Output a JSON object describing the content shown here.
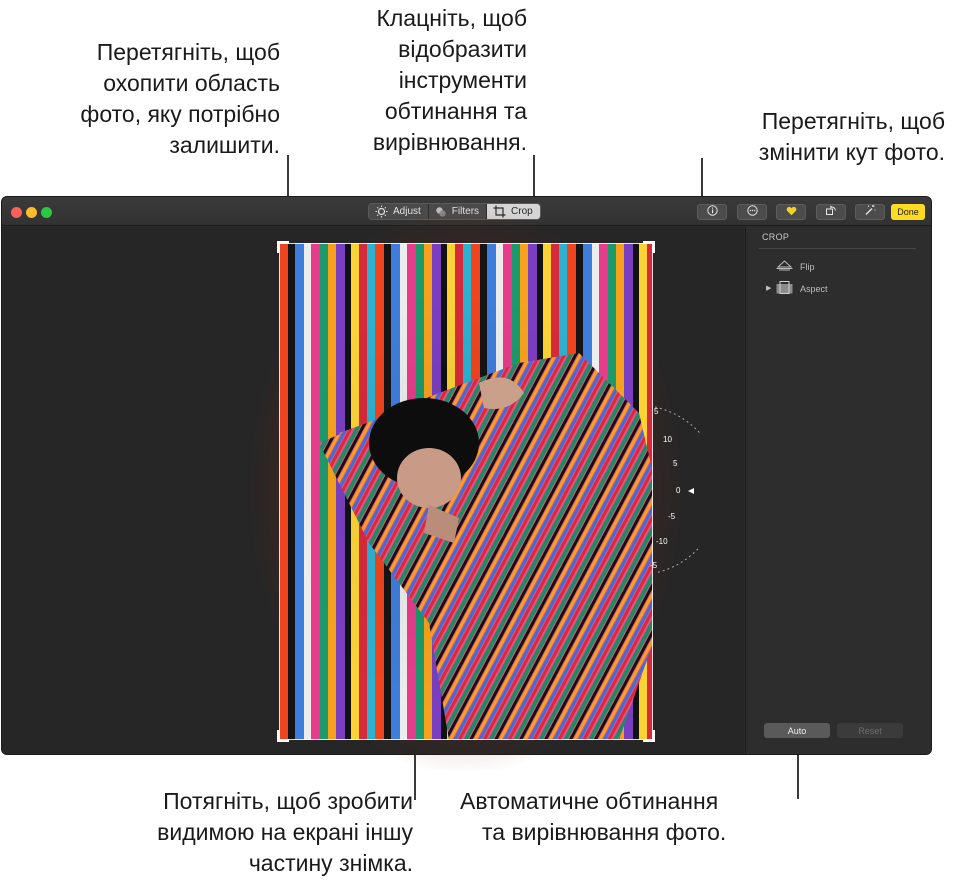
{
  "callouts": {
    "drag_area": [
      "Перетягніть, щоб",
      "охопити область",
      "фото, яку потрібно",
      "залишити."
    ],
    "click_tools": [
      "Клацніть, щоб",
      "відобразити",
      "інструменти",
      "обтинання та",
      "вирівнювання."
    ],
    "drag_angle": [
      "Перетягніть, щоб",
      "змінити кут фото."
    ],
    "drag_view": [
      "Потягніть, щоб зробити",
      "видимою на екрані іншу",
      "частину знімка."
    ],
    "auto_crop": [
      "Автоматичне обтинання",
      "та вирівнювання фото."
    ]
  },
  "toolbar": {
    "tabs": [
      {
        "label": "Adjust",
        "icon": "sun-icon",
        "active": false
      },
      {
        "label": "Filters",
        "icon": "filters-icon",
        "active": false
      },
      {
        "label": "Crop",
        "icon": "crop-icon",
        "active": true
      }
    ],
    "buttons": [
      "info-icon",
      "more-icon",
      "heart-icon",
      "rotate-icon",
      "magic-wand-icon"
    ],
    "done_label": "Done"
  },
  "sidebar": {
    "title": "CROP",
    "items": [
      {
        "label": "Flip",
        "icon": "flip-icon"
      },
      {
        "label": "Aspect",
        "icon": "aspect-icon"
      }
    ],
    "auto_label": "Auto",
    "reset_label": "Reset"
  },
  "angle_dial": {
    "ticks": [
      "5",
      "10",
      "5",
      "0",
      "-5",
      "-10",
      "-5"
    ],
    "value": 0
  },
  "colors": {
    "accent_done": "#fddb22",
    "window_bg": "#2b2b2b",
    "traffic_red": "#fc5f57",
    "traffic_yellow": "#fdbc2e",
    "traffic_green": "#28c840"
  }
}
